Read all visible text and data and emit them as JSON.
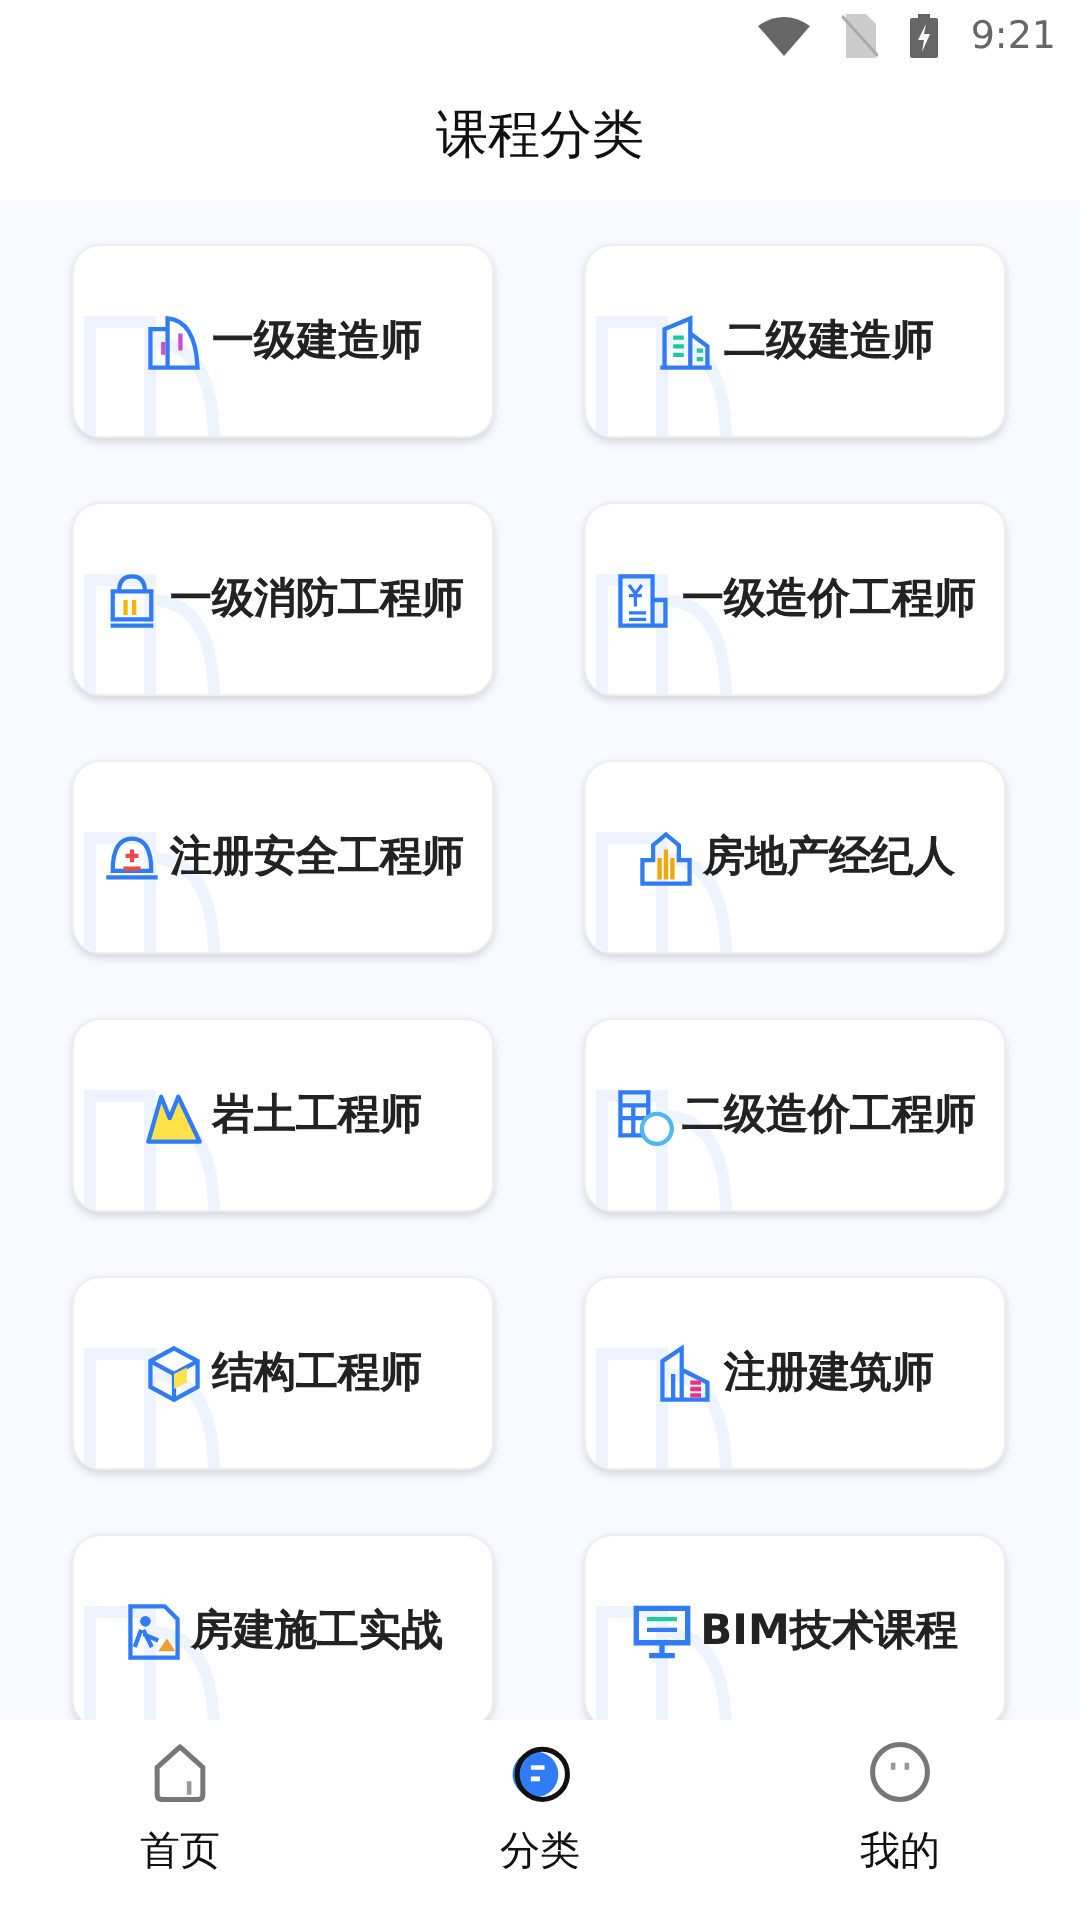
{
  "status_bar": {
    "time": "9:21"
  },
  "header": {
    "title": "课程分类"
  },
  "categories": [
    {
      "label": "一级建造师"
    },
    {
      "label": "二级建造师"
    },
    {
      "label": "一级消防工程师"
    },
    {
      "label": "一级造价工程师"
    },
    {
      "label": "注册安全工程师"
    },
    {
      "label": "房地产经纪人"
    },
    {
      "label": "岩土工程师"
    },
    {
      "label": "二级造价工程师"
    },
    {
      "label": "结构工程师"
    },
    {
      "label": "注册建筑师"
    },
    {
      "label": "房建施工实战"
    },
    {
      "label": "BIM技术课程"
    }
  ],
  "bottom_nav": [
    {
      "label": "首页",
      "selected": false
    },
    {
      "label": "分类",
      "selected": true
    },
    {
      "label": "我的",
      "selected": false
    }
  ]
}
